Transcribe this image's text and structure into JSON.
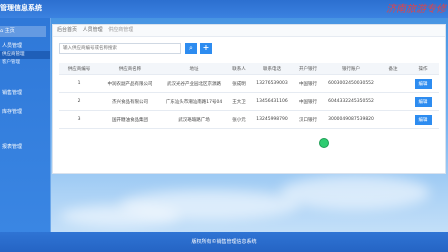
{
  "app": {
    "title": "管理信息系统",
    "watermark": "济南旅游专修"
  },
  "sidebar": {
    "home": "主页",
    "groups": [
      {
        "label": "人员管理",
        "items": [
          "供应商管理",
          "客户管理"
        ]
      },
      {
        "label": "销售管理",
        "items": []
      },
      {
        "label": "库存管理",
        "items": []
      },
      {
        "label": "报表管理",
        "items": []
      }
    ]
  },
  "breadcrumb": {
    "home": "后台首页",
    "section": "人员管理",
    "current": "供应商管理"
  },
  "search": {
    "placeholder": "输入供应商编号或名称搜索",
    "search_icon": "search-icon",
    "add_icon": "plus-icon"
  },
  "table": {
    "headers": [
      "供应商编号",
      "供应商名称",
      "地址",
      "联系人",
      "联系电话",
      "开户银行",
      "银行账户",
      "备注",
      "操作"
    ],
    "rows": [
      [
        "1",
        "中润农副产品有限公司",
        "武汉光谷产业园北区京源路",
        "张成明",
        "13276539003",
        "中国银行",
        "6003002450030552",
        "",
        "编辑"
      ],
      [
        "2",
        "杰兴食品有限公司",
        "广东汕头市潮汕南路17号04",
        "王大卫",
        "13456431106",
        "中国银行",
        "6044332245350552",
        "",
        "编辑"
      ],
      [
        "3",
        "国开糖油食品集团",
        "武汉珞瑜路广场",
        "张小元",
        "13245998790",
        "汉口银行",
        "3000049087539820",
        "",
        "编辑"
      ]
    ]
  },
  "footer": {
    "text": "版权所有©销售管理信息系统"
  },
  "colors": {
    "accent": "#2d8cf0",
    "sidebar": "#2f78d8",
    "watermark": "#ff3b30"
  }
}
